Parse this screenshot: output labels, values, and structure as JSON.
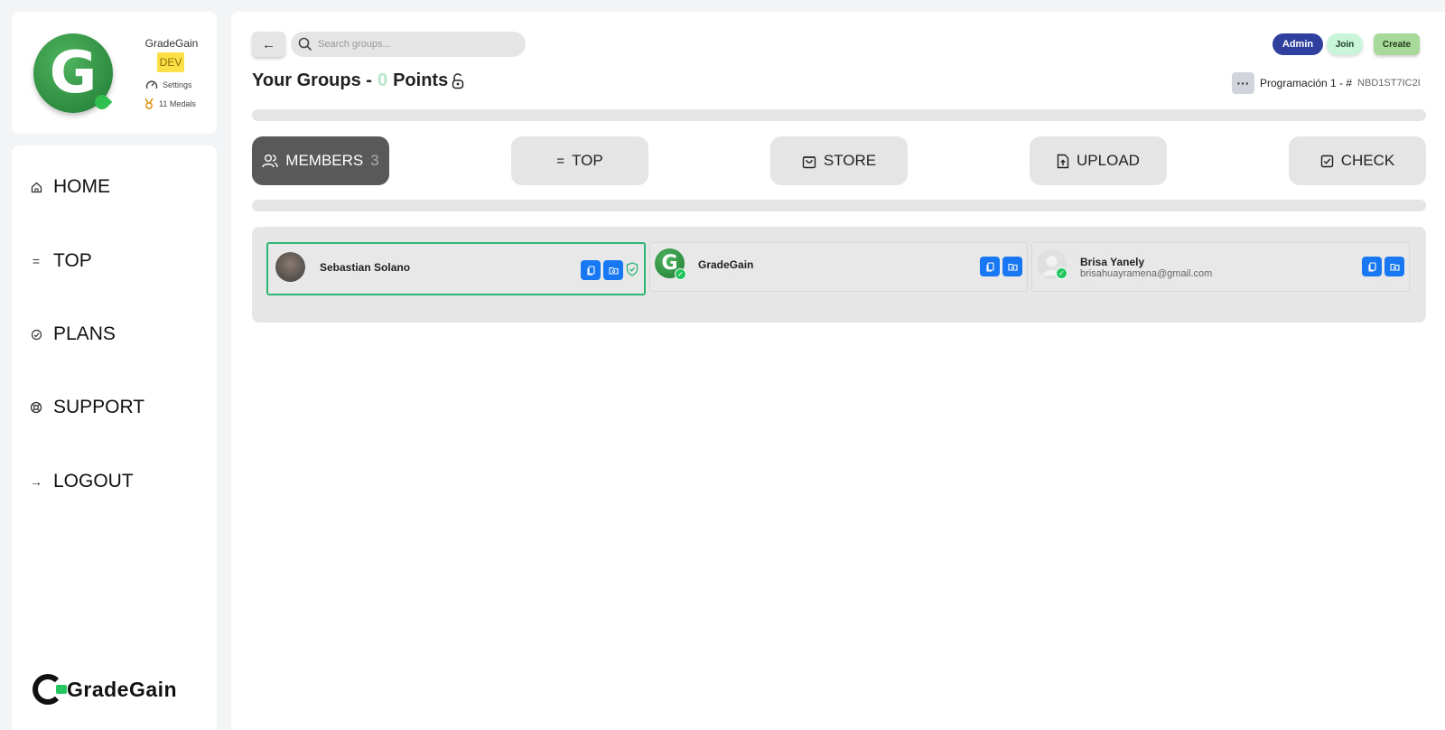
{
  "profile": {
    "name": "GradeGain",
    "badge": "DEV",
    "settings_label": "Settings",
    "medals_label": "11 Medals",
    "avatar_letter": "G"
  },
  "nav": {
    "items": [
      {
        "label": "HOME",
        "icon": "home-icon"
      },
      {
        "label": "TOP",
        "icon": "equals-icon"
      },
      {
        "label": "PLANS",
        "icon": "badge-check-icon"
      },
      {
        "label": "SUPPORT",
        "icon": "lifebuoy-icon"
      },
      {
        "label": "LOGOUT",
        "icon": "arrow-right-icon"
      }
    ],
    "brand": "GradeGain"
  },
  "header": {
    "search_placeholder": "Search groups...",
    "admin_label": "Admin",
    "join_label": "Join",
    "create_label": "Create",
    "title_prefix": "Your Groups -",
    "points": "0",
    "title_suffix": "Points",
    "group_name": "Programación 1 - #",
    "group_code": "NBD1ST7IC2I"
  },
  "tabs": [
    {
      "label": "MEMBERS",
      "count": "3",
      "icon": "users-icon",
      "active": true
    },
    {
      "label": "TOP",
      "icon": "equals-icon"
    },
    {
      "label": "STORE",
      "icon": "shopping-bag-icon"
    },
    {
      "label": "UPLOAD",
      "icon": "file-upload-icon"
    },
    {
      "label": "CHECK",
      "icon": "check-square-icon"
    }
  ],
  "members": [
    {
      "name": "Sebastian Solano",
      "email": "",
      "selected": true,
      "admin_shield": true
    },
    {
      "name": "GradeGain",
      "email": "",
      "verified": true
    },
    {
      "name": "Brisa Yanely",
      "email": "brisahuayramena@gmail.com",
      "verified": true
    }
  ],
  "colors": {
    "accent_green": "#2bb673",
    "admin_blue": "#2f3f9e",
    "action_blue": "#1877f2",
    "dev_yellow": "#fde047"
  }
}
